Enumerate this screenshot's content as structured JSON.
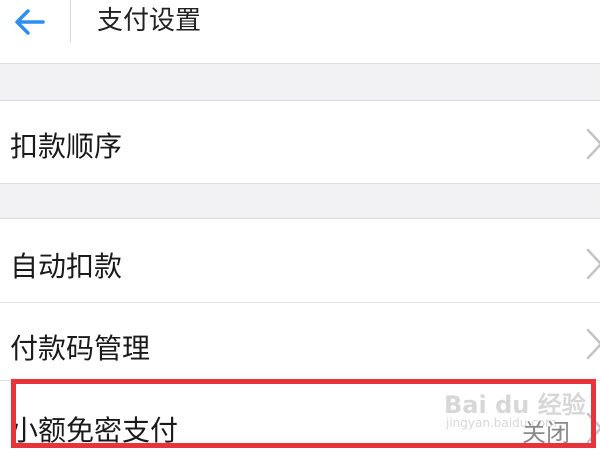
{
  "header": {
    "title": "支付设置",
    "back_icon": "arrow-left-icon",
    "accent_color": "#2f8ff0"
  },
  "settings": {
    "deduction_order": {
      "label": "扣款顺序",
      "icon": "chevron-right-icon"
    },
    "auto_deduct": {
      "label": "自动扣款",
      "icon": "chevron-right-icon"
    },
    "payment_code": {
      "label": "付款码管理",
      "icon": "chevron-right-icon"
    },
    "small_free_pay": {
      "label": "小额免密支付",
      "value": "关闭",
      "icon": "chevron-right-icon"
    }
  },
  "annotation": {
    "highlight_color": "#e8323c"
  },
  "watermark": {
    "main": "Bai du 经验",
    "sub": "jingyan.baidu.com"
  }
}
